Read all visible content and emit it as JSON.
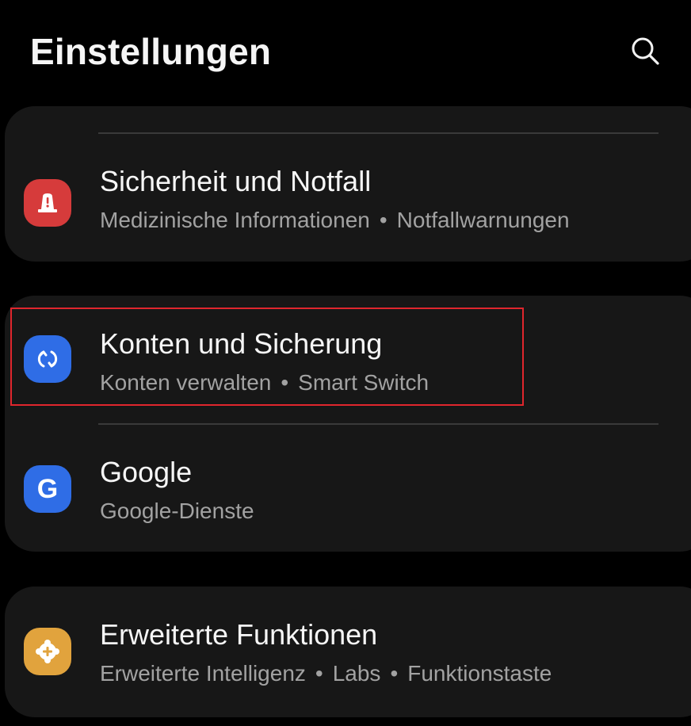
{
  "header": {
    "title": "Einstellungen",
    "search_icon": "search-icon"
  },
  "items": [
    {
      "title": "Sicherheit und Notfall",
      "subtitle_parts": [
        "Medizinische Informationen",
        "Notfallwarnungen"
      ],
      "icon": "emergency-light-icon",
      "icon_color": "#d63b3b"
    },
    {
      "title": "Konten und Sicherung",
      "subtitle_parts": [
        "Konten verwalten",
        "Smart Switch"
      ],
      "icon": "sync-icon",
      "icon_color": "#2f6de6",
      "highlighted": true,
      "highlight_color": "#e0262d"
    },
    {
      "title": "Google",
      "subtitle_parts": [
        "Google-Dienste"
      ],
      "icon": "google-icon",
      "icon_color": "#2f6de6"
    },
    {
      "title": "Erweiterte Funktionen",
      "subtitle_parts": [
        "Erweiterte Intelligenz",
        "Labs",
        "Funktionstaste"
      ],
      "icon": "plus-gear-icon",
      "icon_color": "#e1a33d"
    }
  ],
  "separator": "•"
}
